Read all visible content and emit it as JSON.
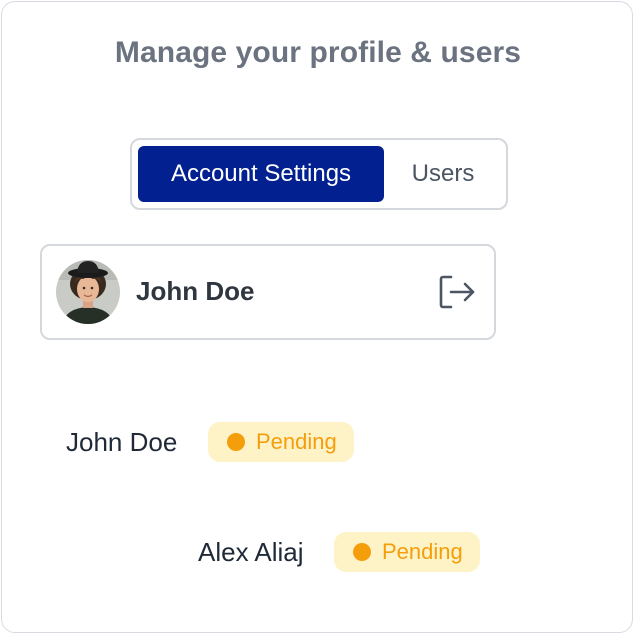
{
  "header": {
    "title": "Manage your profile & users"
  },
  "tabs": {
    "active_label": "Account Settings",
    "inactive_label": "Users"
  },
  "profile": {
    "name": "John Doe",
    "avatar_icon": "user-avatar-photo",
    "logout_icon": "logout-icon"
  },
  "users": [
    {
      "name": "John Doe",
      "status": "Pending"
    },
    {
      "name": "Alex Aliaj",
      "status": "Pending"
    }
  ],
  "colors": {
    "accent": "#02208f",
    "pending_text": "#f59e0b",
    "pending_bg": "#fef3c7"
  }
}
